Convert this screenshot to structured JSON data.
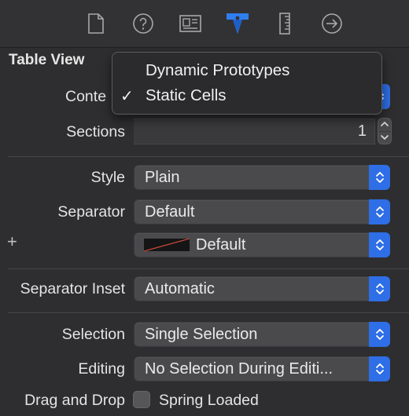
{
  "tabs": [
    {
      "icon": "file-icon"
    },
    {
      "icon": "help-icon"
    },
    {
      "icon": "identity-icon"
    },
    {
      "icon": "attributes-icon",
      "active": true
    },
    {
      "icon": "size-ruler-icon"
    },
    {
      "icon": "connections-arrow-icon"
    }
  ],
  "section": {
    "title": "Table View"
  },
  "content": {
    "label": "Conte",
    "menu": {
      "options": [
        "Dynamic Prototypes",
        "Static Cells"
      ],
      "selected": "Static Cells"
    }
  },
  "sections": {
    "label": "Sections",
    "value": "1"
  },
  "style": {
    "label": "Style",
    "value": "Plain"
  },
  "separator": {
    "label": "Separator",
    "value": "Default"
  },
  "separator_color": {
    "plus": "+",
    "value": "Default",
    "swatch_color": "#151515",
    "slash_color": "#d24a3e"
  },
  "separator_inset": {
    "label": "Separator Inset",
    "value": "Automatic"
  },
  "selection": {
    "label": "Selection",
    "value": "Single Selection"
  },
  "editing": {
    "label": "Editing",
    "value": "No Selection During Editi..."
  },
  "drag_drop": {
    "label": "Drag and Drop",
    "checkbox_label": "Spring Loaded",
    "checked": false
  },
  "colors": {
    "accent": "#2e6ee6",
    "background": "#2e2e30",
    "popup": "#4a4a4d"
  }
}
